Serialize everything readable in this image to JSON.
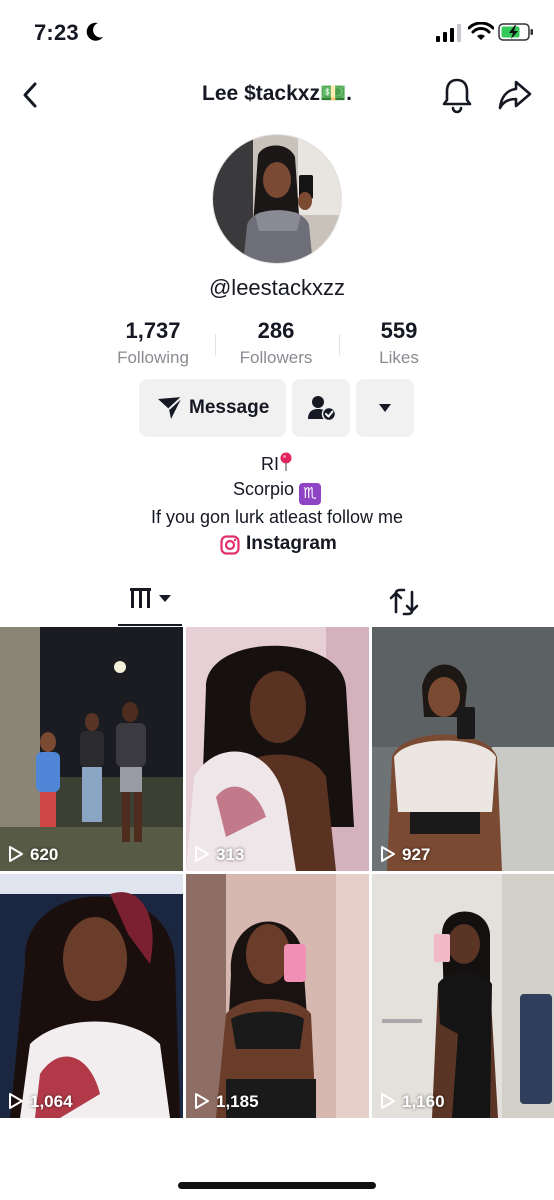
{
  "status_bar": {
    "time": "7:23"
  },
  "header": {
    "title": "Lee $tackxz💵."
  },
  "profile": {
    "username": "@leestackxzz",
    "stats": [
      {
        "value": "1,737",
        "label": "Following"
      },
      {
        "value": "286",
        "label": "Followers"
      },
      {
        "value": "559",
        "label": "Likes"
      }
    ],
    "message_label": "Message",
    "bio": {
      "line1": "RI",
      "line2": "Scorpio",
      "line2_emoji": "♏",
      "line3": "If you gon lurk atleast follow me"
    },
    "instagram_label": "Instagram"
  },
  "videos": [
    {
      "views": "620"
    },
    {
      "views": "313"
    },
    {
      "views": "927"
    },
    {
      "views": "1,064"
    },
    {
      "views": "1,185"
    },
    {
      "views": "1,160"
    }
  ],
  "colors": {
    "text": "#161823",
    "secondary": "#8a8b91",
    "button_bg": "#f1f1f2",
    "instagram": "#e1306c"
  }
}
